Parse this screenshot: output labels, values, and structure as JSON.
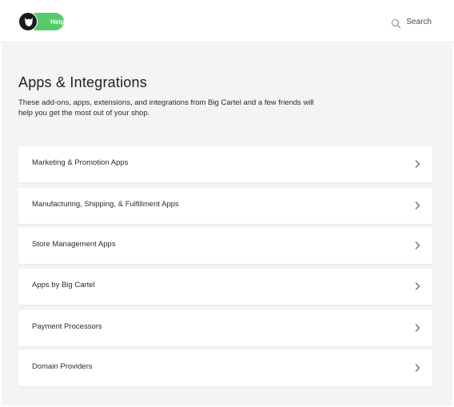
{
  "header": {
    "logo_label": "Help",
    "search_label": "Search"
  },
  "main": {
    "title": "Apps & Integrations",
    "description": "These add-ons, apps, extensions, and integrations from Big Cartel and a few friends will help you get the most out of your shop."
  },
  "categories": [
    {
      "label": "Marketing & Promotion Apps"
    },
    {
      "label": "Manufacturing, Shipping, & Fulfillment Apps"
    },
    {
      "label": "Store Management Apps"
    },
    {
      "label": "Apps by Big Cartel"
    },
    {
      "label": "Payment Processors"
    },
    {
      "label": "Domain Providers"
    }
  ],
  "icons": {
    "logo": "big-cartel-bat-icon",
    "search": "search-icon",
    "chevron": "chevron-right-icon"
  },
  "colors": {
    "brand_green": "#56c96a",
    "logo_dark": "#1a1a1a",
    "page_background": "#f5f4f4"
  }
}
